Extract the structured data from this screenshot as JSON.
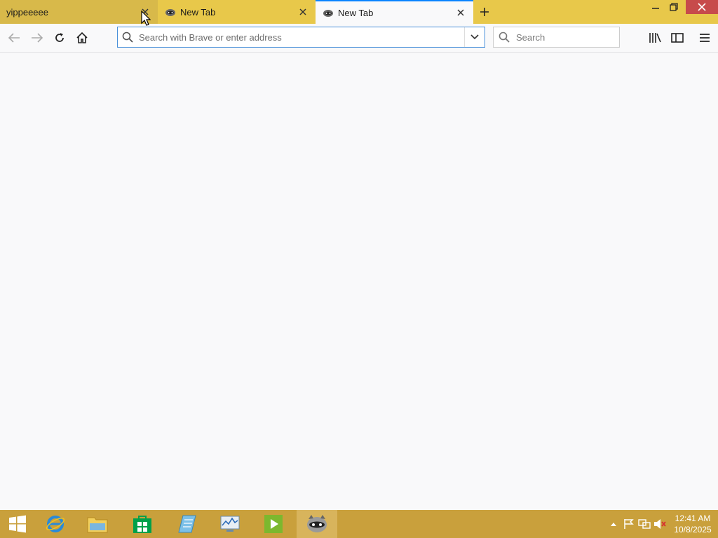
{
  "tabs": [
    {
      "label": "yippeeeee"
    },
    {
      "label": "New Tab"
    },
    {
      "label": "New Tab"
    }
  ],
  "urlbar": {
    "placeholder": "Search with Brave or enter address"
  },
  "searchbar": {
    "placeholder": "Search"
  },
  "clock": {
    "time": "12:41 AM",
    "date": "10/8/2025"
  },
  "colors": {
    "tabbar": "#e8c84a",
    "taskbar": "#c9a03c",
    "accent": "#0a84ff",
    "close_button": "#c74b4b"
  }
}
